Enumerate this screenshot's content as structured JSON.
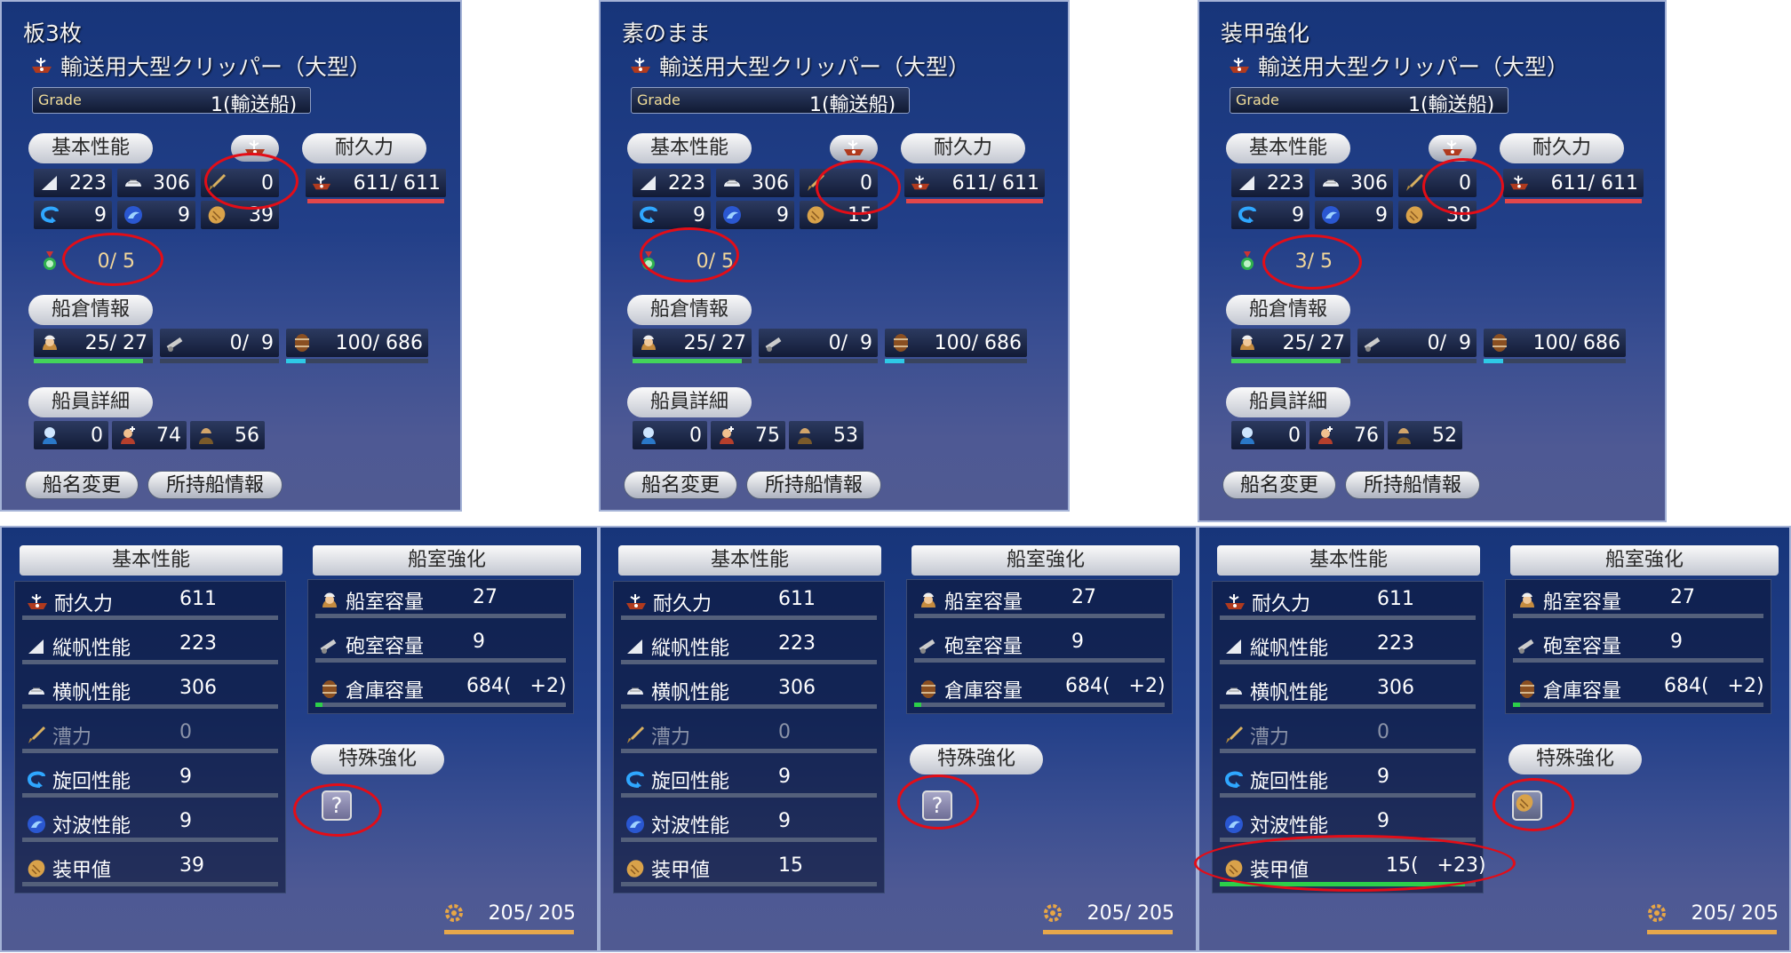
{
  "icons": [
    "ship-icon",
    "sail-icon",
    "square-sail-icon",
    "oar-icon",
    "turn-icon",
    "wave-icon",
    "armor-icon",
    "medal-icon",
    "sailor-icon",
    "cannon-icon",
    "barrel-icon",
    "fighter-icon",
    "navigator-icon",
    "surveyor-icon",
    "gear-icon",
    "question-icon"
  ],
  "top": [
    {
      "title": "板3枚",
      "ship_name": "輸送用大型クリッパー（大型）",
      "grade_label": "Grade",
      "grade_value": "1(輸送船)",
      "h_basic": "基本性能",
      "h_durability": "耐久力",
      "h_hold": "船倉情報",
      "h_crew": "船員詳細",
      "sail_v": "223",
      "sail_h": "306",
      "rowing": "0",
      "turn": "9",
      "wave": "9",
      "armor": "39",
      "durability": "611/ 611",
      "enhance": "0/ 5",
      "cabin": "25/ 27",
      "cannon": "0/  9",
      "cargo": "100/ 686",
      "fight": "0",
      "nav": "74",
      "survey": "56",
      "btn_rename": "船名変更",
      "btn_info": "所持船情報"
    },
    {
      "title": "素のまま",
      "ship_name": "輸送用大型クリッパー（大型）",
      "grade_label": "Grade",
      "grade_value": "1(輸送船)",
      "h_basic": "基本性能",
      "h_durability": "耐久力",
      "h_hold": "船倉情報",
      "h_crew": "船員詳細",
      "sail_v": "223",
      "sail_h": "306",
      "rowing": "0",
      "turn": "9",
      "wave": "9",
      "armor": "15",
      "durability": "611/ 611",
      "enhance": "0/ 5",
      "cabin": "25/ 27",
      "cannon": "0/  9",
      "cargo": "100/ 686",
      "fight": "0",
      "nav": "75",
      "survey": "53",
      "btn_rename": "船名変更",
      "btn_info": "所持船情報"
    },
    {
      "title": "装甲強化",
      "ship_name": "輸送用大型クリッパー（大型）",
      "grade_label": "Grade",
      "grade_value": "1(輸送船)",
      "h_basic": "基本性能",
      "h_durability": "耐久力",
      "h_hold": "船倉情報",
      "h_crew": "船員詳細",
      "sail_v": "223",
      "sail_h": "306",
      "rowing": "0",
      "turn": "9",
      "wave": "9",
      "armor": "38",
      "durability": "611/ 611",
      "enhance": "3/ 5",
      "cabin": "25/ 27",
      "cannon": "0/  9",
      "cargo": "100/ 686",
      "fight": "0",
      "nav": "76",
      "survey": "52",
      "btn_rename": "船名変更",
      "btn_info": "所持船情報"
    }
  ],
  "bottom": [
    {
      "h_basic": "基本性能",
      "h_cabin": "船室強化",
      "h_special": "特殊強化",
      "stats": [
        [
          "耐久力",
          "611"
        ],
        [
          "縦帆性能",
          "223"
        ],
        [
          "横帆性能",
          "306"
        ],
        [
          "漕力",
          "0"
        ],
        [
          "旋回性能",
          "9"
        ],
        [
          "対波性能",
          "9"
        ],
        [
          "装甲値",
          "39"
        ]
      ],
      "cabin": [
        [
          "船室容量",
          "27"
        ],
        [
          "砲室容量",
          "9"
        ],
        [
          "倉庫容量",
          "684(   +2)"
        ]
      ],
      "special": "?",
      "footer": "205/ 205"
    },
    {
      "h_basic": "基本性能",
      "h_cabin": "船室強化",
      "h_special": "特殊強化",
      "stats": [
        [
          "耐久力",
          "611"
        ],
        [
          "縦帆性能",
          "223"
        ],
        [
          "横帆性能",
          "306"
        ],
        [
          "漕力",
          "0"
        ],
        [
          "旋回性能",
          "9"
        ],
        [
          "対波性能",
          "9"
        ],
        [
          "装甲値",
          "15"
        ]
      ],
      "cabin": [
        [
          "船室容量",
          "27"
        ],
        [
          "砲室容量",
          "9"
        ],
        [
          "倉庫容量",
          "684(   +2)"
        ]
      ],
      "special": "?",
      "footer": "205/ 205"
    },
    {
      "h_basic": "基本性能",
      "h_cabin": "船室強化",
      "h_special": "特殊強化",
      "stats": [
        [
          "耐久力",
          "611"
        ],
        [
          "縦帆性能",
          "223"
        ],
        [
          "横帆性能",
          "306"
        ],
        [
          "漕力",
          "0"
        ],
        [
          "旋回性能",
          "9"
        ],
        [
          "対波性能",
          "9"
        ],
        [
          "装甲値",
          "15(   +23)"
        ]
      ],
      "cabin": [
        [
          "船室容量",
          "27"
        ],
        [
          "砲室容量",
          "9"
        ],
        [
          "倉庫容量",
          "684(   +2)"
        ]
      ],
      "special": "armor",
      "footer": "205/ 205"
    }
  ]
}
